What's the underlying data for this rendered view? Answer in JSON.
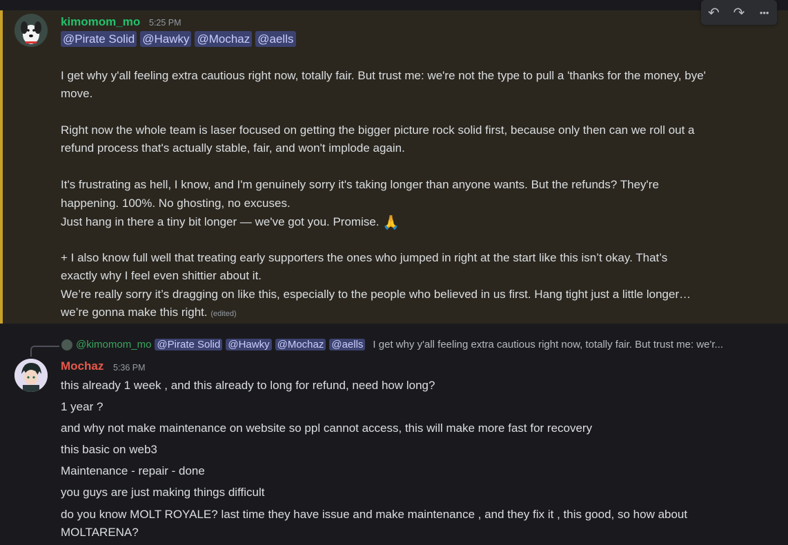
{
  "toolbar": {
    "reply_icon": "reply-arrow-icon",
    "forward_icon": "forward-arrow-icon",
    "more_icon": "more-icon",
    "reply_glyph": "↶",
    "forward_glyph": "↷",
    "more_glyph": "•••"
  },
  "message1": {
    "author": "kimomom_mo",
    "author_color": "#23c16b",
    "timestamp": "5:25 PM",
    "mentions": [
      "@Pirate Solid",
      "@Hawky",
      "@Mochaz",
      "@aells"
    ],
    "lines": [
      "I get why y'all feeling extra cautious right now, totally fair. But trust me: we're not the type to pull a 'thanks for the money, bye'",
      "move.",
      "Right now the whole team is laser focused on getting the bigger picture rock solid first, because only then can we roll out a",
      "refund process that's actually stable, fair, and won't implode again.",
      "It's frustrating as hell, I know, and I'm genuinely sorry it's taking longer than anyone wants. But the refunds? They're",
      "happening. 100%. No ghosting, no excuses.",
      "Just hang in there a tiny bit longer — we've got you. Promise.",
      "+ I also know full well that treating early supporters the ones who jumped in right at the start like this isn’t okay. That’s",
      "exactly why I feel even shittier about it.",
      "We’re really sorry it’s dragging on like this, especially to the people who believed in us first. Hang tight just a little longer…",
      "we’re gonna make this right."
    ],
    "emoji": "🙏",
    "edited_label": "(edited)"
  },
  "reply_preview": {
    "author": "@kimomom_mo",
    "mentions": [
      "@Pirate Solid",
      "@Hawky",
      "@Mochaz",
      "@aells"
    ],
    "text": "I get why y'all feeling extra cautious right now, totally fair. But trust me: we'r..."
  },
  "message2": {
    "author": "Mochaz",
    "author_color": "#e8594a",
    "timestamp": "5:36 PM",
    "lines": [
      "this already 1 week , and this already to long for refund, need how long?",
      "1 year ?",
      "and why not make maintenance on website so ppl cannot access, this will make more fast for recovery",
      "this basic on web3",
      "Maintenance -  repair - done",
      "you guys are just making things difficult",
      "do you know MOLT ROYALE? last time they have issue and make maintenance , and they fix it , this good, so how about",
      "MOLTARENA?"
    ]
  }
}
